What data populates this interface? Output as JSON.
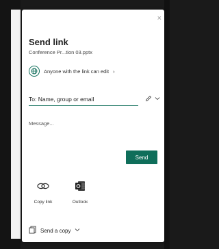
{
  "dialog": {
    "title": "Send link",
    "filename": "Conference Pr...tion 03.pptx",
    "permission": "Anyone with the link can edit",
    "permission_chevron": "›",
    "to_placeholder": "To: Name, group or email",
    "message_placeholder": "Message...",
    "send_label": "Send",
    "copy_link_label": "Copy link",
    "outlook_label": "Outlook",
    "send_copy_label": "Send a copy",
    "close_glyph": "×"
  },
  "colors": {
    "accent": "#0f6e5a",
    "panel_bg": "#ffffff",
    "backdrop": "#1a1a1a"
  },
  "icons": {
    "close": "close-icon",
    "globe": "globe-icon",
    "pencil": "pencil-icon",
    "chevron": "chevron-down-icon",
    "link": "link-icon",
    "outlook": "outlook-icon",
    "document": "document-icon"
  }
}
